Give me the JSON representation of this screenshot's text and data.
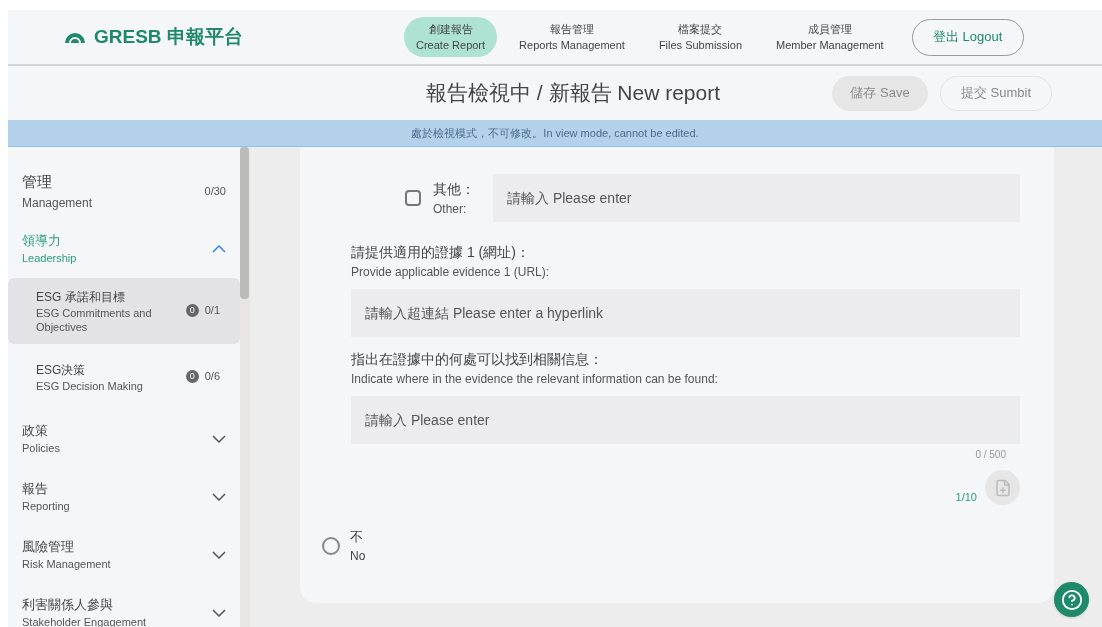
{
  "logo": {
    "text": "GRESB 申報平台"
  },
  "nav": [
    {
      "zh": "創建報告",
      "en": "Create Report",
      "selected": true
    },
    {
      "zh": "報告管理",
      "en": "Reports Management",
      "selected": false
    },
    {
      "zh": "檔案提交",
      "en": "Files Submission",
      "selected": false
    },
    {
      "zh": "成員管理",
      "en": "Member Management",
      "selected": false
    }
  ],
  "logout": "登出 Logout",
  "title": "報告檢視中 / 新報告 New report",
  "actions": [
    {
      "label": "儲存 Save",
      "kind": "filled",
      "disabled": true
    },
    {
      "label": "提交 Sumbit",
      "kind": "outline",
      "disabled": true
    }
  ],
  "banner": "處於檢視模式，不可修改。In view mode, cannot be edited.",
  "sidebar": {
    "heading": {
      "zh": "管理",
      "en": "Management",
      "count": "0/30"
    },
    "groups": [
      {
        "zh": "領導力",
        "en": "Leadership",
        "expanded": true,
        "children": [
          {
            "zh": "ESG 承諾和目標",
            "en": "ESG Commitments and Objectives",
            "badge": "0",
            "count": "0/1",
            "selected": true
          },
          {
            "zh": "ESG決策",
            "en": "ESG Decision Making",
            "badge": "0",
            "count": "0/6",
            "selected": false
          }
        ]
      },
      {
        "zh": "政策",
        "en": "Policies",
        "expanded": false
      },
      {
        "zh": "報告",
        "en": "Reporting",
        "expanded": false
      },
      {
        "zh": "風險管理",
        "en": "Risk Management",
        "expanded": false
      },
      {
        "zh": "利害關係人參與",
        "en": "Stakeholder Engagement",
        "expanded": false
      }
    ]
  },
  "other": {
    "checked": false,
    "zh": "其他：",
    "en": "Other:",
    "placeholder": "請輸入 Please enter"
  },
  "evidence": {
    "zh": "請提供適用的證據 1 (網址)：",
    "en": "Provide applicable evidence 1 (URL):",
    "placeholder": "請輸入超連結 Please enter a hyperlink"
  },
  "location": {
    "zh": "指出在證據中的何處可以找到相關信息：",
    "en": "Indicate where in the evidence the relevant information can be found:",
    "placeholder": "請輸入 Please enter",
    "counter": "0 / 500"
  },
  "files": {
    "count": "1/10"
  },
  "no_option": {
    "zh": "不",
    "en": "No",
    "selected": false
  }
}
